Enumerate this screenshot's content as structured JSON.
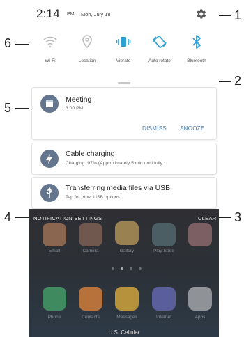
{
  "status_bar": {
    "time": "2:14",
    "ampm": "PM",
    "date": "Mon, July 18"
  },
  "quick_settings": [
    {
      "label": "Wi-Fi",
      "icon": "wifi-icon"
    },
    {
      "label": "Location",
      "icon": "location-icon"
    },
    {
      "label": "Vibrate",
      "icon": "vibrate-icon"
    },
    {
      "label": "Auto rotate",
      "icon": "auto-rotate-icon"
    },
    {
      "label": "Bluetooth",
      "icon": "bluetooth-icon"
    }
  ],
  "notifications": {
    "meeting": {
      "title": "Meeting",
      "time": "3:00 PM",
      "dismiss": "DISMISS",
      "snooze": "SNOOZE"
    },
    "charging": {
      "title": "Cable charging",
      "detail": "Charging: 97% (Approximately 5 min until fully."
    },
    "usb": {
      "title": "Transferring media files via USB",
      "detail": "Tap for other USB options."
    }
  },
  "footer": {
    "settings": "NOTIFICATION SETTINGS",
    "clear": "CLEAR"
  },
  "home_apps_row1": [
    "Email",
    "Camera",
    "Gallery",
    "Play Store",
    ""
  ],
  "home_apps_row2": [
    "Phone",
    "Contacts",
    "Messages",
    "Internet",
    "Apps"
  ],
  "carrier": "U.S. Cellular",
  "callouts": {
    "c1": "1",
    "c2": "2",
    "c3": "3",
    "c4": "4",
    "c5": "5",
    "c6": "6"
  },
  "colors": {
    "accent": "#4a7ab0",
    "qs_active": "#2e9fd6",
    "qs_inactive": "#bdbdbd",
    "icon_circle": "#64768e"
  }
}
